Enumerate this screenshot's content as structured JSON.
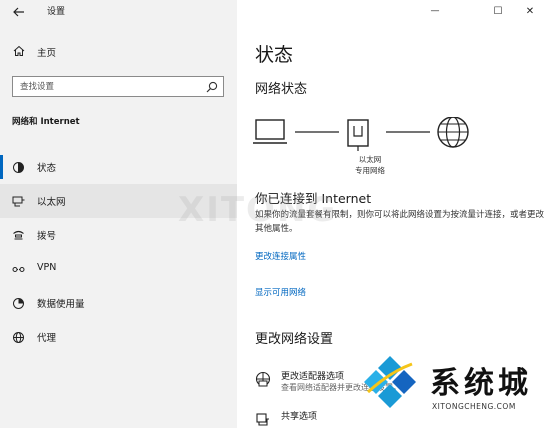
{
  "window": {
    "app_title": "设置",
    "controls": {
      "minimize": "—",
      "maximize": "☐",
      "close": "✕"
    }
  },
  "sidebar": {
    "home_label": "主页",
    "search_placeholder": "查找设置",
    "section_title": "网络和 Internet",
    "items": [
      {
        "label": "状态",
        "icon": "status-icon",
        "selected": true
      },
      {
        "label": "以太网",
        "icon": "ethernet-icon",
        "hovered": true
      },
      {
        "label": "拨号",
        "icon": "dialup-icon"
      },
      {
        "label": "VPN",
        "icon": "vpn-icon"
      },
      {
        "label": "数据使用量",
        "icon": "data-usage-icon"
      },
      {
        "label": "代理",
        "icon": "proxy-icon"
      }
    ]
  },
  "main": {
    "page_title": "状态",
    "network_status_title": "网络状态",
    "diagram": {
      "adapter_label": "以太网",
      "network_label": "专用网络"
    },
    "connected_title": "你已连接到 Internet",
    "description": "如果你的流量套餐有限制，则你可以将此网络设置为按流量计连接，或者更改其他属性。",
    "link_change_properties": "更改连接属性",
    "link_show_networks": "显示可用网络",
    "change_settings_title": "更改网络设置",
    "options": [
      {
        "title": "更改适配器选项",
        "subtitle": "查看网络适配器并更改连接设置。",
        "icon": "adapter-icon"
      },
      {
        "title": "共享选项",
        "subtitle": "",
        "icon": "sharing-icon"
      }
    ]
  },
  "watermark": {
    "brand_text": "系统城",
    "brand_url": "XITONGCHENG.COM"
  },
  "colors": {
    "accent": "#0067c0",
    "sidebar_bg": "#f2f2f2",
    "hover_bg": "#e5e5e5",
    "logo_blue": "#1a9ad6",
    "logo_dark_blue": "#1565c0"
  }
}
